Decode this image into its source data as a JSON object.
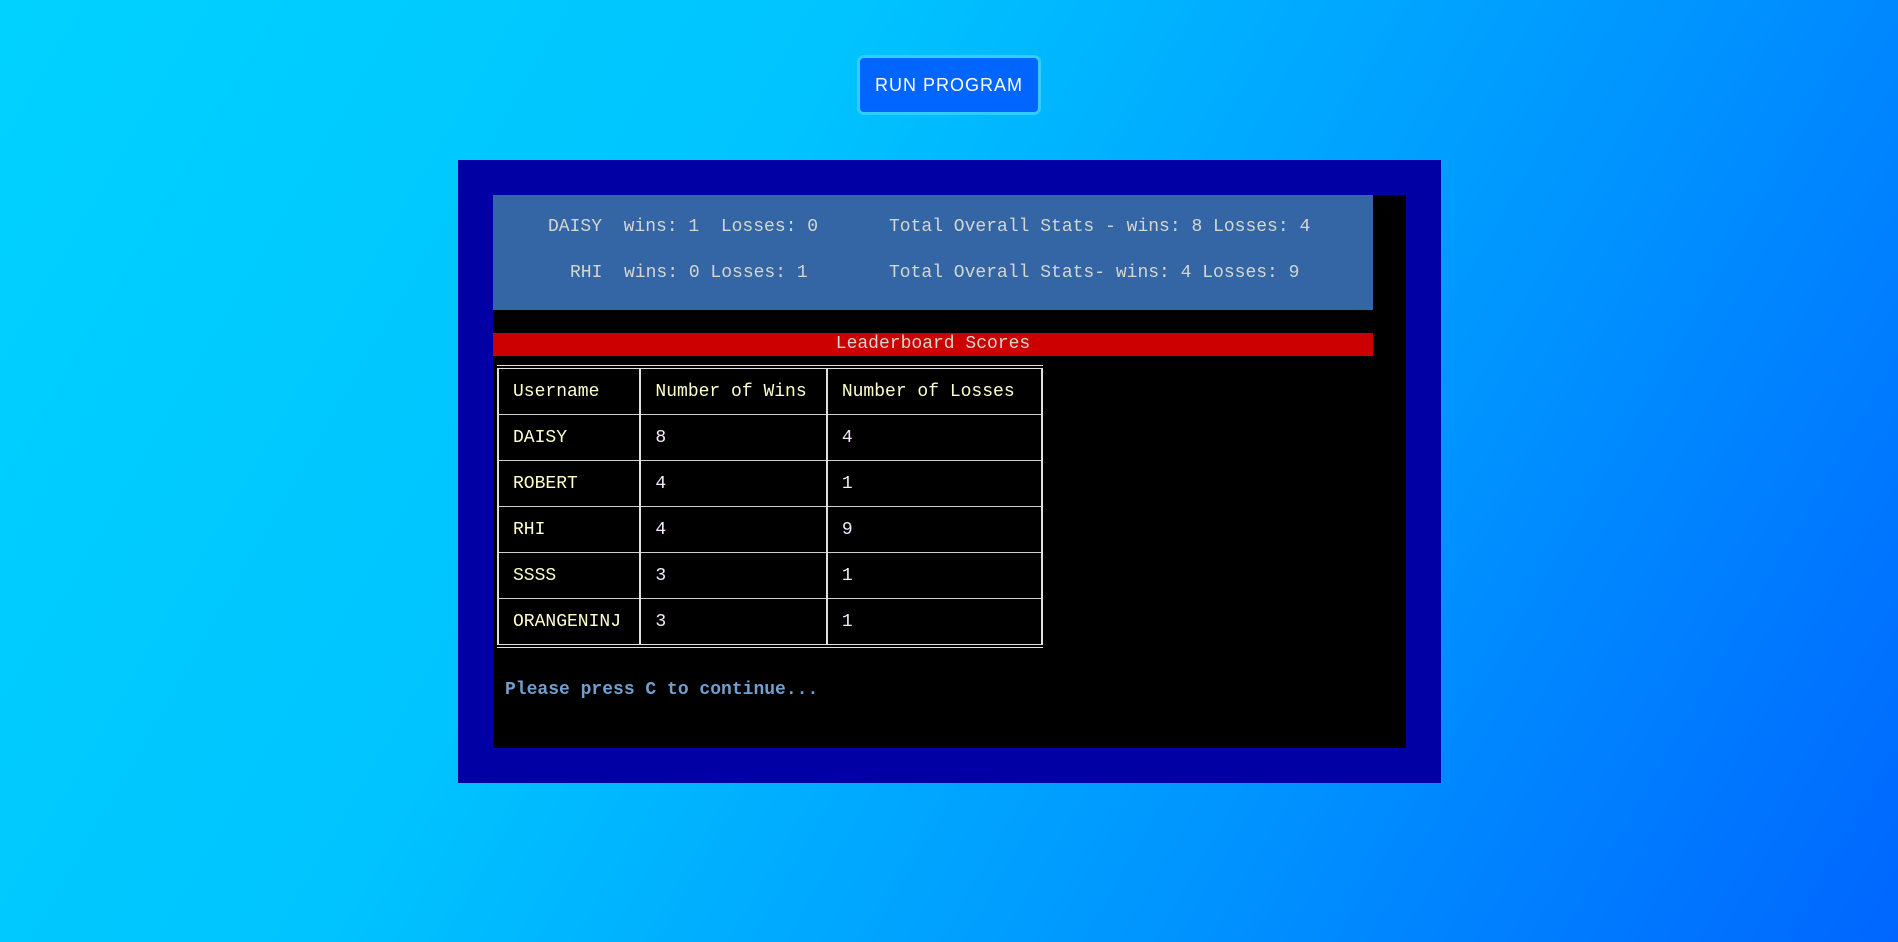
{
  "run_button": {
    "label": "RUN PROGRAM"
  },
  "stats": {
    "line1_player": "DAISY  wins: 1  Losses: 0",
    "line1_total": "Total Overall Stats - wins: 8 Losses: 4",
    "line2_player": "RHI  wins: 0 Losses: 1",
    "line2_total": "Total Overall Stats- wins: 4 Losses: 9"
  },
  "leaderboard": {
    "title": "Leaderboard Scores",
    "headers": [
      "Username",
      "Number of Wins",
      "Number of Losses"
    ],
    "rows": [
      [
        "DAISY",
        "8",
        "4"
      ],
      [
        "ROBERT",
        "4",
        "1"
      ],
      [
        "RHI",
        "4",
        "9"
      ],
      [
        "SSSS",
        "3",
        "1"
      ],
      [
        "ORANGENINJ",
        "3",
        "1"
      ]
    ]
  },
  "prompt": "Please press C to continue...",
  "colors": {
    "background_start": "#00d2ff",
    "background_end": "#0066ff",
    "frame": "#0000a4",
    "stats_panel": "#3465a4",
    "leader_bar": "#cc0000",
    "prompt_text": "#729fcf"
  }
}
